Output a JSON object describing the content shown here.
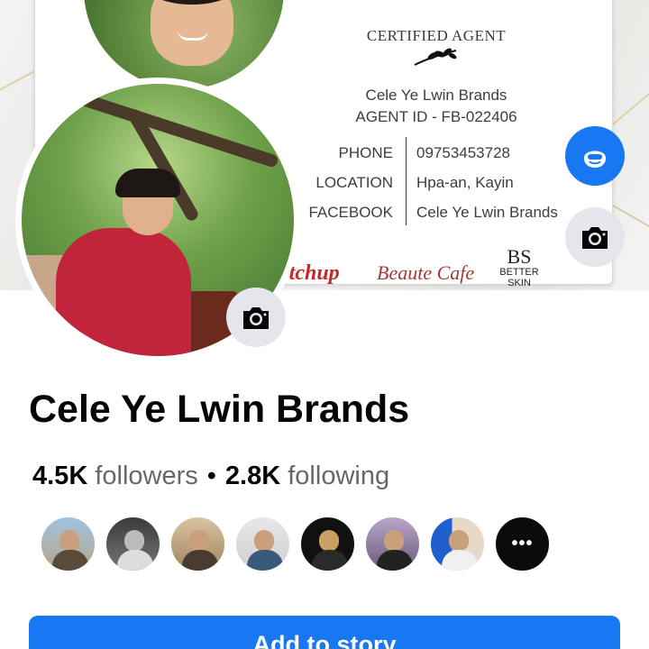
{
  "cover": {
    "card": {
      "title": "CERTIFIED AGENT",
      "brand": "Cele Ye Lwin Brands",
      "agent_id": "AGENT ID - FB-022406",
      "rows": [
        {
          "label": "PHONE",
          "value": "09753453728"
        },
        {
          "label": "LOCATION",
          "value": "Hpa-an, Kayin"
        },
        {
          "label": "FACEBOOK",
          "value": "Cele Ye Lwin Brands"
        }
      ],
      "logos": {
        "ketchup": "ketchup",
        "beaute": "Beaute Cafe",
        "bs": "BS",
        "bs_sub": "BETTER SKIN"
      }
    }
  },
  "profile": {
    "name": "Cele Ye Lwin Brands",
    "followers_count": "4.5K",
    "followers_label": "followers",
    "separator": "•",
    "following_count": "2.8K",
    "following_label": "following"
  },
  "icons": {
    "cover_camera": "camera-icon",
    "profile_camera": "camera-icon",
    "edit": "avatar-edit-icon",
    "more": "more-icon"
  },
  "friends": {
    "more_glyph": "•••"
  },
  "actions": {
    "add_to_story": "Add to story"
  },
  "colors": {
    "accent": "#1877f2",
    "button_gray": "#e4e6eb",
    "text_primary": "#050505",
    "text_secondary": "#65676b"
  }
}
